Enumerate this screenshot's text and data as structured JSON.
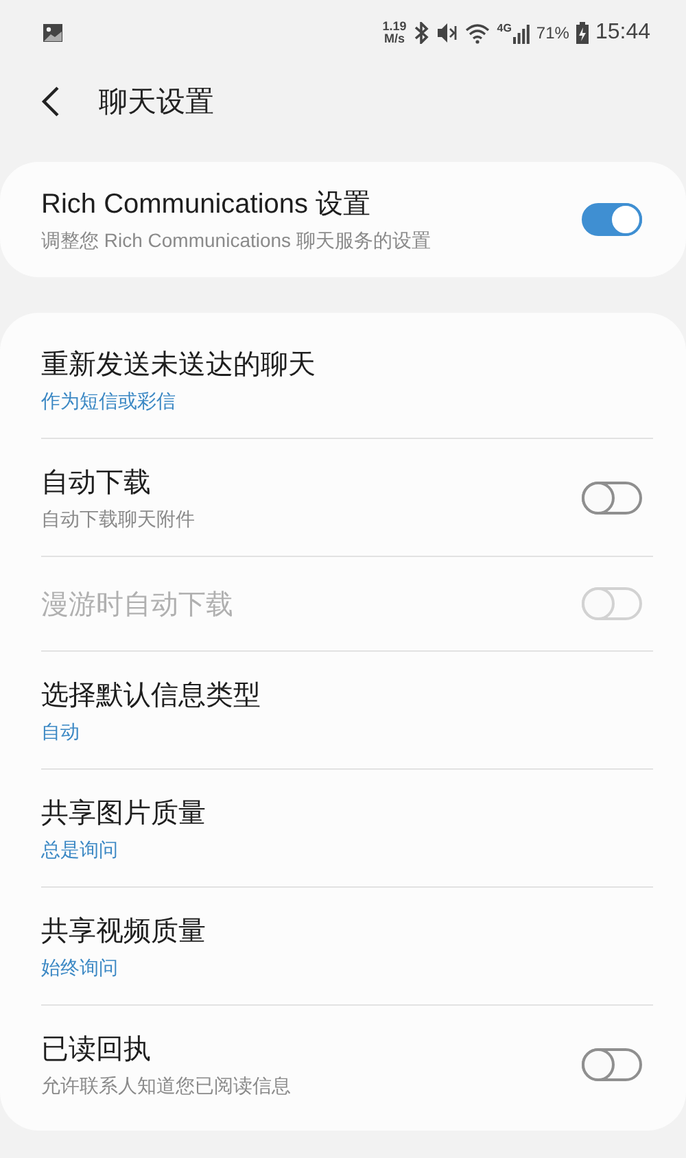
{
  "status_bar": {
    "speed": "1.19",
    "speed_unit": "M/s",
    "network": "4G",
    "battery": "71%",
    "time": "15:44"
  },
  "header": {
    "title": "聊天设置"
  },
  "master": {
    "title": "Rich Communications 设置",
    "summary": "调整您 Rich Communications 聊天服务的设置",
    "on": true
  },
  "items": [
    {
      "kind": "value",
      "title": "重新发送未送达的聊天",
      "summary": "作为短信或彩信",
      "disabled": false
    },
    {
      "kind": "toggle",
      "title": "自动下载",
      "summary": "自动下载聊天附件",
      "on": false,
      "disabled": false
    },
    {
      "kind": "toggle",
      "title": "漫游时自动下载",
      "on": false,
      "disabled": true
    },
    {
      "kind": "value",
      "title": "选择默认信息类型",
      "summary": "自动",
      "disabled": false
    },
    {
      "kind": "value",
      "title": "共享图片质量",
      "summary": "总是询问",
      "disabled": false
    },
    {
      "kind": "value",
      "title": "共享视频质量",
      "summary": "始终询问",
      "disabled": false
    },
    {
      "kind": "toggle",
      "title": "已读回执",
      "summary": "允许联系人知道您已阅读信息",
      "on": false,
      "disabled": false
    }
  ]
}
